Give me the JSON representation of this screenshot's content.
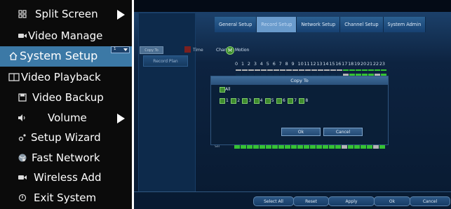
{
  "menu": {
    "items": [
      {
        "label": "Split Screen",
        "icon": "grid-icon",
        "submenu": true,
        "selected": false
      },
      {
        "label": "Video Manage",
        "icon": "camera-icon",
        "submenu": false,
        "selected": false
      },
      {
        "label": "System Setup",
        "icon": "home-icon",
        "submenu": false,
        "selected": true
      },
      {
        "label": "Video Playback",
        "icon": "playback-screen-icon",
        "submenu": false,
        "selected": false
      },
      {
        "label": "Video Backup",
        "icon": "floppy-disk-icon",
        "submenu": false,
        "selected": false
      },
      {
        "label": "Volume",
        "icon": "speaker-icon",
        "submenu": true,
        "selected": false
      },
      {
        "label": "Setup Wizard",
        "icon": "wizard-icon",
        "submenu": false,
        "selected": false
      },
      {
        "label": "Fast Network",
        "icon": "globe-network-icon",
        "submenu": false,
        "selected": false
      },
      {
        "label": "Wireless Add",
        "icon": "wireless-camera-icon",
        "submenu": false,
        "selected": false
      },
      {
        "label": "Exit System",
        "icon": "power-icon",
        "submenu": false,
        "selected": false
      }
    ]
  },
  "dialog": {
    "left_panel_item": "Record Plan",
    "tabs": [
      {
        "label": "General Setup",
        "active": false
      },
      {
        "label": "Record Setup",
        "active": true
      },
      {
        "label": "Network Setup",
        "active": false
      },
      {
        "label": "Channel Setup",
        "active": false
      },
      {
        "label": "System Admin",
        "active": false
      }
    ],
    "channel_label": "Channel",
    "channel_value": "1",
    "copy_to_button": "Copy To",
    "time_label": "Time",
    "motion_label": "Motion",
    "hours": [
      "0",
      "1",
      "2",
      "3",
      "4",
      "5",
      "6",
      "7",
      "8",
      "9",
      "10",
      "11",
      "12",
      "13",
      "14",
      "15",
      "16",
      "17",
      "18",
      "19",
      "20",
      "21",
      "22",
      "23"
    ],
    "schedule_colors": {
      "green": "#35c233",
      "gray": "#b5b5b5",
      "dark": "#0b2a48"
    },
    "select_all_label": "Sel",
    "copy_dialog": {
      "title": "Copy To",
      "all_label": "All",
      "channels": [
        "1",
        "2",
        "3",
        "4",
        "5",
        "6",
        "7",
        "8"
      ],
      "ok": "Ok",
      "cancel": "Cancel"
    },
    "bottom_buttons": [
      "Select All",
      "Reset",
      "Apply",
      "Ok",
      "Cancel"
    ]
  },
  "colors": {
    "menu_bg": "#0b0b0b",
    "menu_selected": "#3c79a6",
    "dialog_bg": "#0d2340",
    "accent_green": "#35c233"
  }
}
